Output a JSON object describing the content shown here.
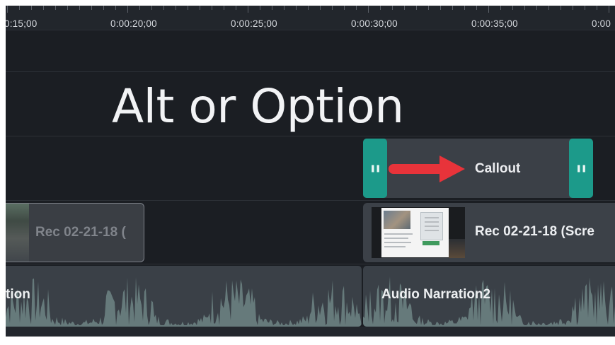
{
  "ruler": {
    "labels": [
      "0:15;00",
      "0:00:20;00",
      "0:00:25;00",
      "0:00:30;00",
      "0:00:35;00",
      "0:00"
    ]
  },
  "title_clip": {
    "text": "Alt or Option"
  },
  "callout_clip": {
    "label": "Callout",
    "accent_color": "#1c9a8a",
    "arrow_color": "#e8333a"
  },
  "media_clips": {
    "left_label": "Rec 02-21-18 (",
    "right_label": "Rec 02-21-18 (Scre"
  },
  "audio_clips": {
    "left_label": "tion",
    "right_label": "Audio Narration2"
  },
  "icons": [
    "callout-handle-grip-icon",
    "arrow-right-icon"
  ]
}
